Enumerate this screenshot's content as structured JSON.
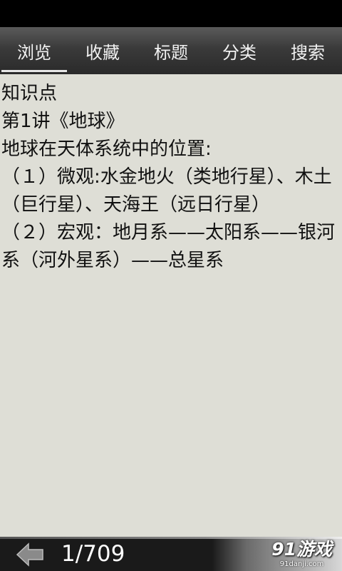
{
  "tabs": [
    {
      "label": "浏览",
      "active": true
    },
    {
      "label": "收藏",
      "active": false
    },
    {
      "label": "标题",
      "active": false
    },
    {
      "label": "分类",
      "active": false
    },
    {
      "label": "搜索",
      "active": false
    }
  ],
  "content": {
    "lines": [
      "知识点",
      "第1讲《地球》",
      "地球在天体系统中的位置:",
      "（１）微观:水金地火（类地行星）、木土（巨行星）、天海王（远日行星）",
      "（２）宏观：地月系——太阳系——银河系（河外星系）——总星系"
    ]
  },
  "footer": {
    "back_icon": "back-arrow-icon",
    "page_counter": "1/709",
    "logo_text": "91游戏",
    "logo_url": "91danji.com"
  },
  "colors": {
    "background": "#deded6",
    "tab_bar": "#3a3a3a",
    "text": "#111111"
  }
}
